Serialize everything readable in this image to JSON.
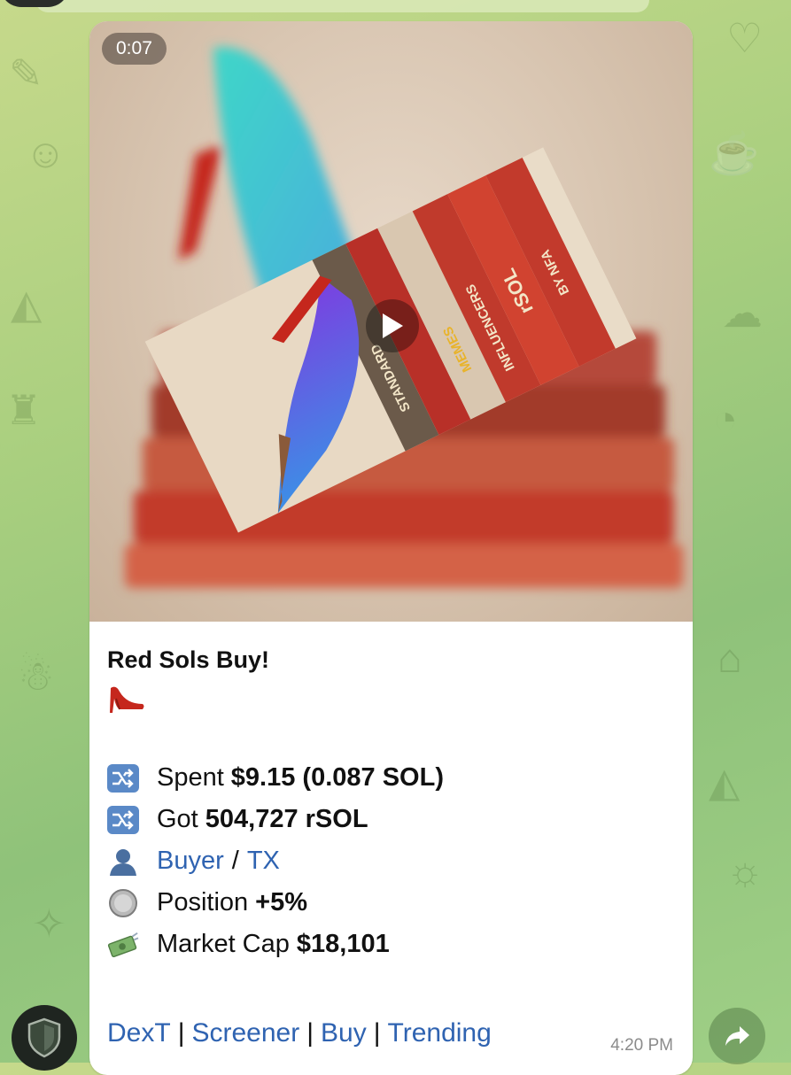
{
  "video": {
    "duration": "0:07"
  },
  "message": {
    "title": "Red Sols Buy!",
    "spent": {
      "label": "Spent",
      "value": "$9.15 (0.087 SOL)"
    },
    "got": {
      "label": "Got",
      "value": "504,727 rSOL"
    },
    "links": {
      "buyer": "Buyer",
      "slash": "/",
      "tx": "TX"
    },
    "position": {
      "label": "Position",
      "value": "+5%"
    },
    "market_cap": {
      "label": "Market Cap",
      "value": "$18,101"
    },
    "bottom_links": [
      "DexT",
      "Screener",
      "Buy",
      "Trending"
    ],
    "bottom_separator": "|",
    "time": "4:20 PM"
  },
  "image_text": {
    "book_spines": [
      "STANDARD",
      "MEMES",
      "INFLUENCERS",
      "rSOL",
      "BY NFA"
    ]
  },
  "colors": {
    "link": "#2f63b1",
    "heel_red": "#c5271d",
    "heel_teal": "#3fd6c8",
    "heel_purple": "#7c3ee0",
    "book_red": "#c23a2c"
  },
  "icons": [
    "shuffle-icon",
    "user-icon",
    "coin-icon",
    "money-icon",
    "play-icon",
    "shield-icon",
    "share-arrow-icon",
    "high-heel-emoji"
  ]
}
